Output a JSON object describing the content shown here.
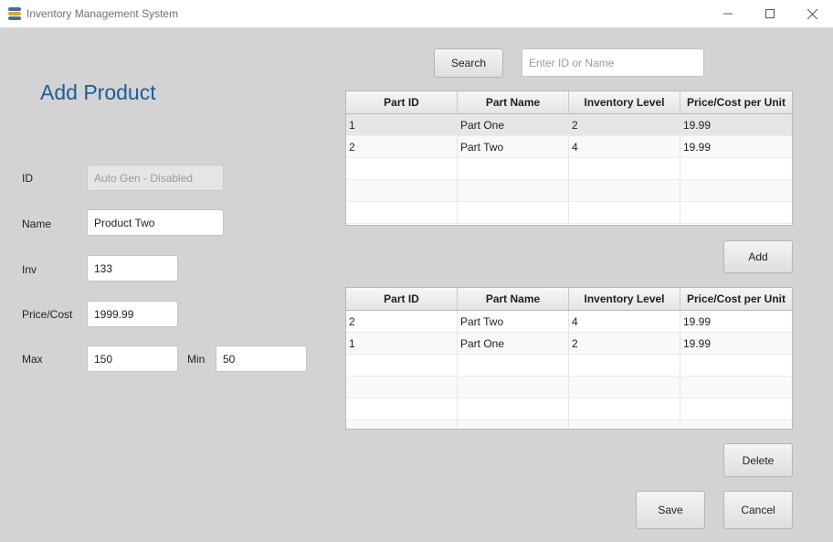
{
  "window": {
    "title": "Inventory Management System",
    "minimize_glyph": "─",
    "maximize_glyph": "☐",
    "close_glyph": "✕"
  },
  "page_title": "Add Product",
  "form": {
    "id": {
      "label": "ID",
      "placeholder": "Auto Gen - Disabled"
    },
    "name": {
      "label": "Name",
      "value": "Product Two"
    },
    "inv": {
      "label": "Inv",
      "value": "133"
    },
    "price": {
      "label": "Price/Cost",
      "value": "1999.99"
    },
    "max": {
      "label": "Max",
      "value": "150"
    },
    "min": {
      "label": "Min",
      "value": "50"
    }
  },
  "search": {
    "button_label": "Search",
    "placeholder": "Enter ID or Name"
  },
  "columns": [
    "Part ID",
    "Part Name",
    "Inventory Level",
    "Price/Cost per Unit"
  ],
  "all_parts": [
    [
      "1",
      "Part One",
      "2",
      "19.99"
    ],
    [
      "2",
      "Part Two",
      "4",
      "19.99"
    ]
  ],
  "associated_parts": [
    [
      "2",
      "Part Two",
      "4",
      "19.99"
    ],
    [
      "1",
      "Part One",
      "2",
      "19.99"
    ]
  ],
  "buttons": {
    "add": "Add",
    "delete": "Delete",
    "save": "Save",
    "cancel": "Cancel"
  },
  "icons": {
    "app": "database-icon"
  }
}
